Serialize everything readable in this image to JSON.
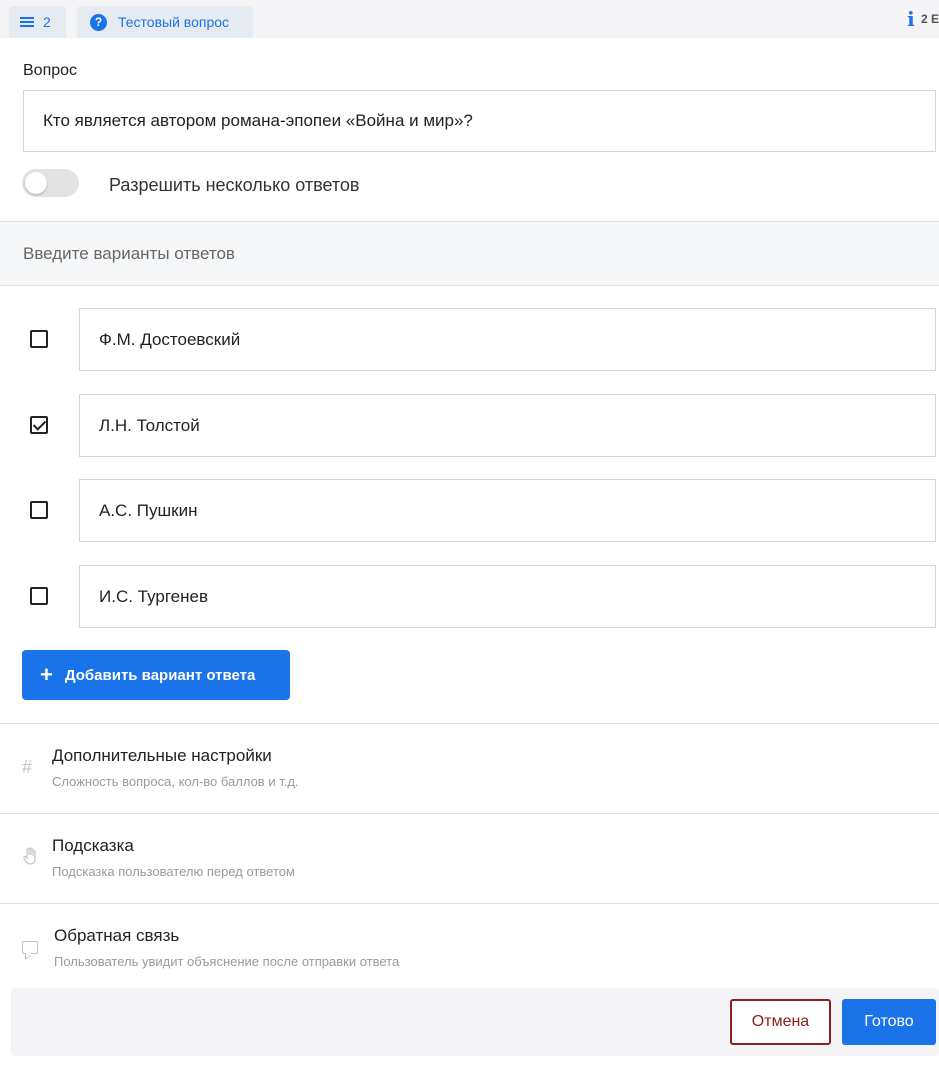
{
  "tabs": {
    "count_icon": "menu-icon",
    "count": "2",
    "title_icon": "help-circle-icon",
    "title": "Тестовый вопрос"
  },
  "top_right": {
    "icon": "info-icon",
    "text": "2 Е"
  },
  "question": {
    "label": "Вопрос",
    "value": "Кто является автором романа-эпопеи «Война и мир»?"
  },
  "multiple_answers": {
    "label": "Разрешить несколько ответов",
    "enabled": false
  },
  "answers_header": "Введите варианты ответов",
  "answers": [
    {
      "text": "Ф.М. Достоевский",
      "checked": false
    },
    {
      "text": "Л.Н. Толстой",
      "checked": true
    },
    {
      "text": "А.С. Пушкин",
      "checked": false
    },
    {
      "text": "И.С. Тургенев",
      "checked": false
    }
  ],
  "add_answer": {
    "icon": "plus-icon",
    "label": "Добавить вариант ответа"
  },
  "sections": [
    {
      "icon": "hash-icon",
      "title": "Дополнительные настройки",
      "subtitle": "Сложность вопроса, кол-во баллов и т.д."
    },
    {
      "icon": "hand-icon",
      "title": "Подсказка",
      "subtitle": "Подсказка пользователю перед ответом"
    },
    {
      "icon": "comment-icon",
      "title": "Обратная связь",
      "subtitle": "Пользователь увидит объяснение после отправки ответа"
    }
  ],
  "footer": {
    "cancel": "Отмена",
    "done": "Готово"
  },
  "colors": {
    "accent": "#1a73e8",
    "cancel": "#8b1e1e"
  }
}
